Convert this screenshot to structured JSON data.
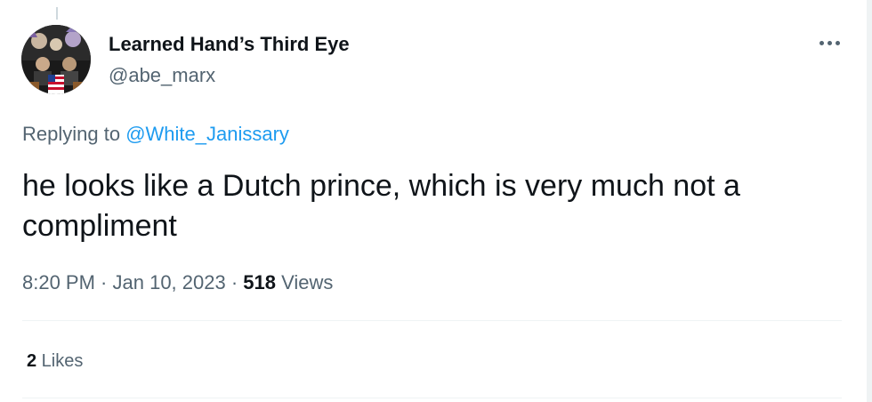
{
  "author": {
    "display_name": "Learned Hand’s Third Eye",
    "handle": "@abe_marx"
  },
  "reply": {
    "prefix": "Replying to ",
    "mention": "@White_Janissary"
  },
  "tweet": {
    "text": "he looks like a Dutch prince, which is very much not a compliment"
  },
  "meta": {
    "time": "8:20 PM",
    "separator": " · ",
    "date": "Jan 10, 2023",
    "views_count": "518",
    "views_label": " Views"
  },
  "stats": {
    "likes_count": "2",
    "likes_label": " Likes"
  },
  "icons": {
    "more": "more-horizontal-icon"
  },
  "colors": {
    "link": "#1d9bf0",
    "secondary_text": "#536471",
    "primary_text": "#0f1419",
    "divider": "#eff3f4"
  }
}
